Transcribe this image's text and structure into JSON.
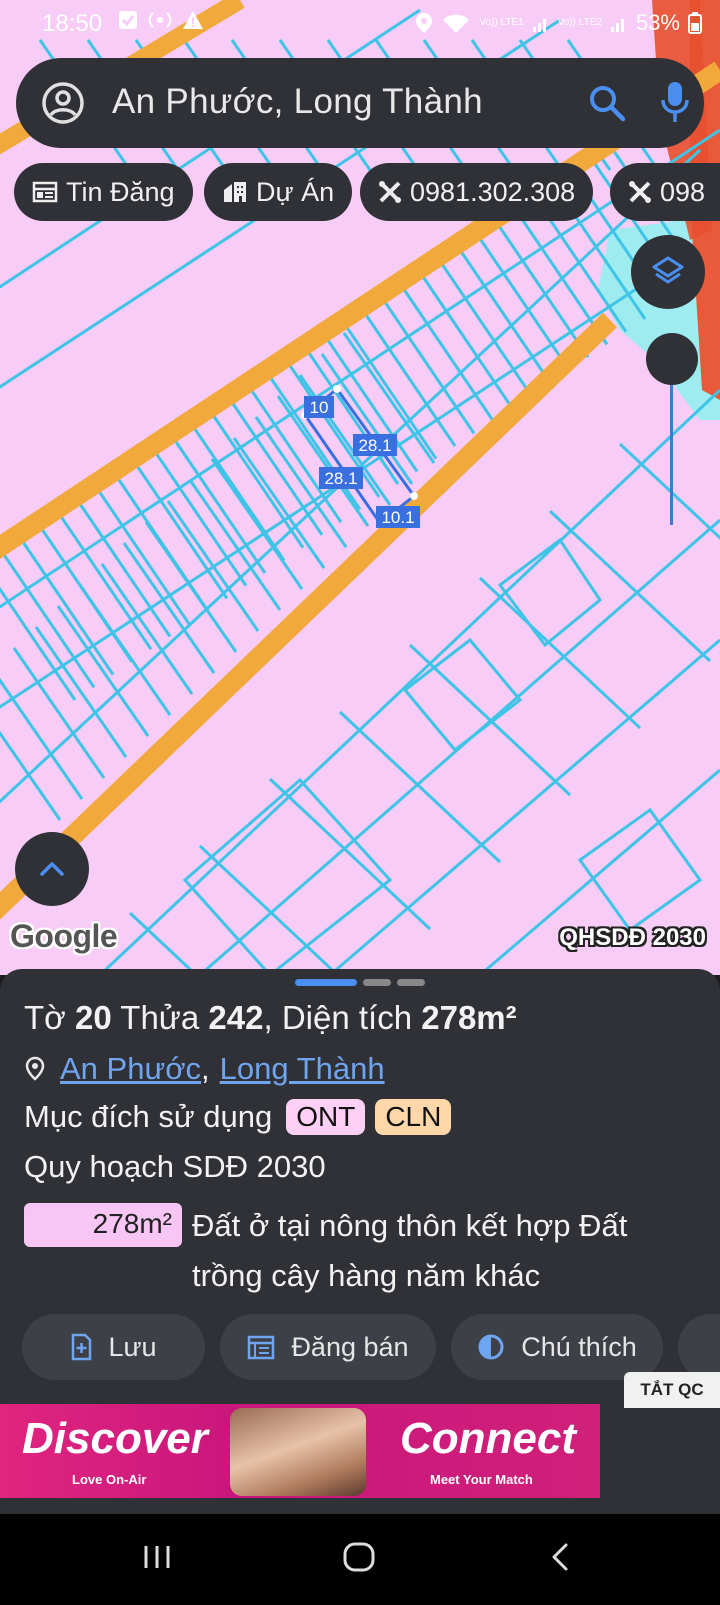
{
  "status_bar": {
    "time": "18:50",
    "battery": "53%",
    "sim1": "Vo)) LTE1",
    "sim2": "Vo)) LTE2"
  },
  "search": {
    "query": "An Phước, Long Thành"
  },
  "chips": [
    {
      "label": "Tin Đăng",
      "icon": "newspaper-icon"
    },
    {
      "label": "Dự Án",
      "icon": "buildings-icon"
    },
    {
      "label": "0981.302.308",
      "icon": "tools-icon"
    },
    {
      "label": "098",
      "icon": "tools-icon"
    }
  ],
  "map": {
    "parcel_labels": [
      "10",
      "28.1",
      "28.1",
      "10.1"
    ],
    "attribution": "Google",
    "layer_name": "QHSDĐ 2030",
    "colors": {
      "land_fill": "#f7ccf6",
      "road": "#f2a93b",
      "parcel_lines": "#3ec4e6",
      "water": "#9eecef",
      "highlight": "#3a6fe0"
    }
  },
  "sheet": {
    "to_label": "Tờ",
    "to_value": "20",
    "thua_label": "Thửa",
    "thua_value": "242",
    "area_label": ", Diện tích",
    "area_value": "278m²",
    "location_commune": "An Phước",
    "location_separator": ",",
    "location_district": "Long Thành",
    "usage_label": "Mục đích sử dụng",
    "usage_tags": [
      "ONT",
      "CLN"
    ],
    "plan_label": "Quy hoạch SDĐ 2030",
    "plan_area": "278m²",
    "plan_description": "Đất ở tại nông thôn kết hợp Đất trồng cây hàng năm khác"
  },
  "actions": [
    {
      "label": "Lưu",
      "icon": "bookmark-add-icon"
    },
    {
      "label": "Đăng bán",
      "icon": "calendar-list-icon"
    },
    {
      "label": "Chú thích",
      "icon": "half-circle-icon"
    }
  ],
  "ad": {
    "dismiss_label": "TẮT QC",
    "left_word": "Discover",
    "left_sub": "Love On-Air",
    "right_word": "Connect",
    "right_sub": "Meet Your Match"
  }
}
